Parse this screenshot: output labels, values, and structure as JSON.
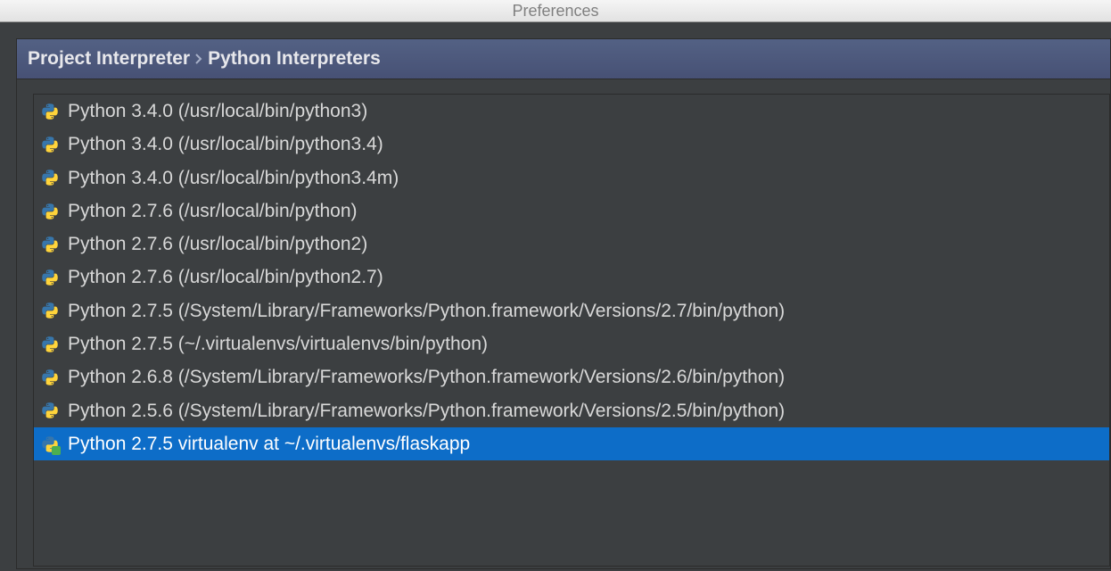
{
  "window": {
    "title": "Preferences"
  },
  "breadcrumb": {
    "part1": "Project Interpreter",
    "part2": "Python Interpreters"
  },
  "interpreters": [
    {
      "label": "Python 3.4.0 (/usr/local/bin/python3)",
      "selected": false,
      "virtualenv": false
    },
    {
      "label": "Python 3.4.0 (/usr/local/bin/python3.4)",
      "selected": false,
      "virtualenv": false
    },
    {
      "label": "Python 3.4.0 (/usr/local/bin/python3.4m)",
      "selected": false,
      "virtualenv": false
    },
    {
      "label": "Python 2.7.6 (/usr/local/bin/python)",
      "selected": false,
      "virtualenv": false
    },
    {
      "label": "Python 2.7.6 (/usr/local/bin/python2)",
      "selected": false,
      "virtualenv": false
    },
    {
      "label": "Python 2.7.6 (/usr/local/bin/python2.7)",
      "selected": false,
      "virtualenv": false
    },
    {
      "label": "Python 2.7.5 (/System/Library/Frameworks/Python.framework/Versions/2.7/bin/python)",
      "selected": false,
      "virtualenv": false
    },
    {
      "label": "Python 2.7.5 (~/.virtualenvs/virtualenvs/bin/python)",
      "selected": false,
      "virtualenv": false
    },
    {
      "label": "Python 2.6.8 (/System/Library/Frameworks/Python.framework/Versions/2.6/bin/python)",
      "selected": false,
      "virtualenv": false
    },
    {
      "label": "Python 2.5.6 (/System/Library/Frameworks/Python.framework/Versions/2.5/bin/python)",
      "selected": false,
      "virtualenv": false
    },
    {
      "label": "Python 2.7.5 virtualenv at ~/.virtualenvs/flaskapp",
      "selected": true,
      "virtualenv": true
    }
  ]
}
